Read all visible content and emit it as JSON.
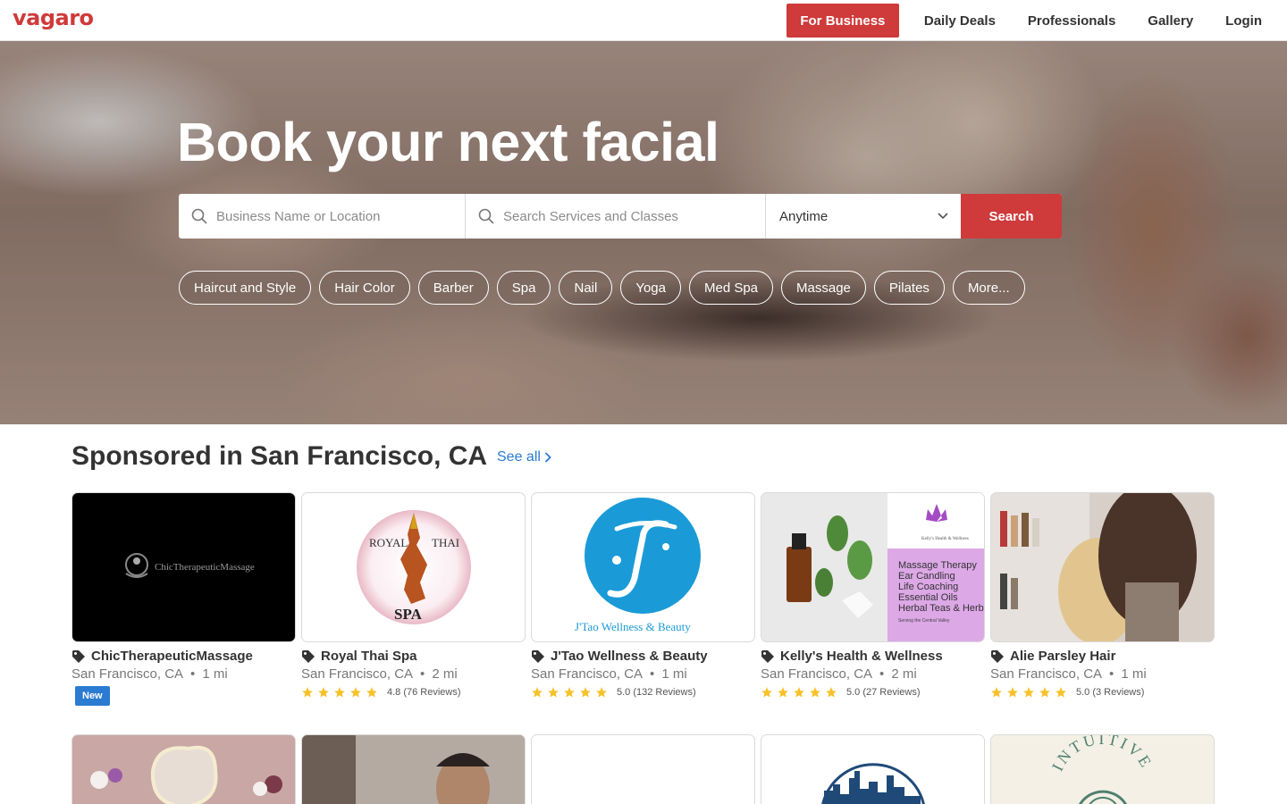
{
  "header": {
    "logo": "vagaro",
    "for_business": "For Business",
    "nav": [
      "Daily Deals",
      "Professionals",
      "Gallery",
      "Login"
    ]
  },
  "hero": {
    "title": "Book your next facial",
    "search": {
      "location_placeholder": "Business Name or Location",
      "service_placeholder": "Search Services and Classes",
      "time_value": "Anytime",
      "button": "Search"
    },
    "chips": [
      "Haircut and Style",
      "Hair Color",
      "Barber",
      "Spa",
      "Nail",
      "Yoga",
      "Med Spa",
      "Massage",
      "Pilates",
      "More..."
    ]
  },
  "sponsored": {
    "title": "Sponsored in San Francisco, CA",
    "see_all": "See all",
    "cards": [
      {
        "name": "ChicTherapeuticMassage",
        "location": "San Francisco, CA",
        "distance": "1 mi",
        "badge": "New",
        "logo_text": "ChicTherapeuticMassage"
      },
      {
        "name": "Royal Thai Spa",
        "location": "San Francisco, CA",
        "distance": "2 mi",
        "rating": "4.8 (76 Reviews)",
        "logo_top_left": "ROYAL",
        "logo_top_right": "THAI",
        "logo_bottom": "SPA"
      },
      {
        "name": "J'Tao Wellness & Beauty",
        "location": "San Francisco, CA",
        "distance": "1 mi",
        "rating": "5.0 (132 Reviews)",
        "logo_text": "J'Tao Wellness & Beauty"
      },
      {
        "name": "Kelly's Health & Wellness",
        "location": "San Francisco, CA",
        "distance": "2 mi",
        "rating": "5.0 (27 Reviews)",
        "logo_lines": [
          "Massage Therapy",
          "Ear Candling",
          "Life Coaching",
          "Essential Oils",
          "Herbal Teas & Herbs"
        ],
        "logo_sub": "Serving the Central Valley",
        "logo_brand": "Kelly's Health & Wellness"
      },
      {
        "name": "Alie Parsley Hair",
        "location": "San Francisco, CA",
        "distance": "1 mi",
        "rating": "5.0 (3 Reviews)"
      }
    ],
    "row2": {
      "intuitive_text": "INTUITIVE"
    }
  },
  "colors": {
    "brand": "#cf3a3a",
    "link": "#2a7bd1",
    "star": "#f6c22b"
  }
}
